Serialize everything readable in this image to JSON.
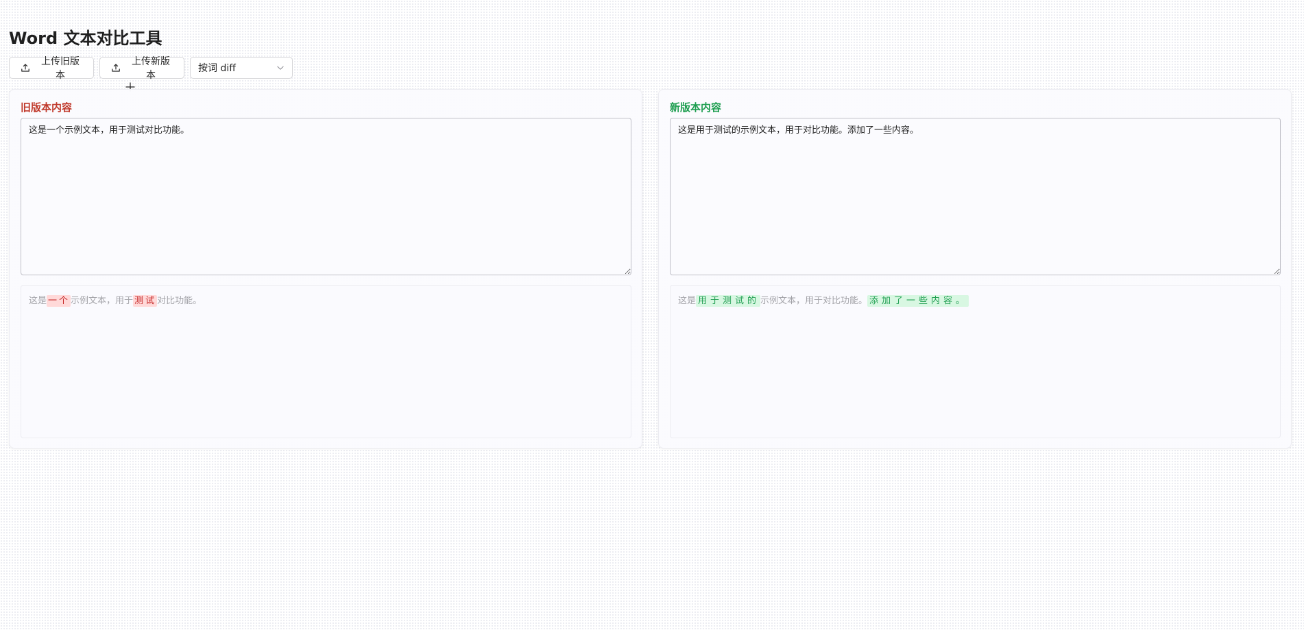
{
  "title": "Word 文本对比工具",
  "toolbar": {
    "upload_old_label": "上传旧版本",
    "upload_new_label": "上传新版本",
    "mode_select_value": "按词 diff",
    "upload_icon": "upload-icon",
    "select_icon": "chevron-down-icon"
  },
  "panels": {
    "old": {
      "label": "旧版本内容",
      "label_color": "#c0392b",
      "text": "这是一个示例文本，用于测试对比功能。",
      "diff": [
        {
          "text": "这是",
          "type": "same"
        },
        {
          "text": "一个",
          "type": "removed"
        },
        {
          "text": "示例文本，用于",
          "type": "same"
        },
        {
          "text": "测试",
          "type": "removed"
        },
        {
          "text": "对比功能。",
          "type": "same"
        }
      ]
    },
    "new": {
      "label": "新版本内容",
      "label_color": "#1e9e50",
      "text": "这是用于测试的示例文本，用于对比功能。添加了一些内容。",
      "diff": [
        {
          "text": "这是",
          "type": "same"
        },
        {
          "text": "用于测试的",
          "type": "added"
        },
        {
          "text": "示例文本，用于对比功能。",
          "type": "same"
        },
        {
          "text": "添加了一些内容。",
          "type": "added"
        }
      ]
    }
  },
  "colors": {
    "removed_bg": "#ffd9d9",
    "removed_text": "#c62828",
    "added_bg": "#d8f7e2",
    "added_text": "#1e9e50",
    "unchanged_text": "#a3a3a8"
  }
}
